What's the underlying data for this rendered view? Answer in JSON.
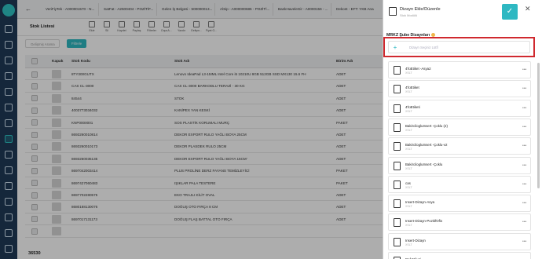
{
  "tabs": [
    {
      "label": "VeriFiyTek - A000001570 - N..."
    },
    {
      "label": "SatFat - A2500404 - POZİTİF..."
    },
    {
      "label": "Gelen İş Belgesi - 500000013..."
    },
    {
      "label": "AlSip - A000000685 - POZİTİ..."
    },
    {
      "label": "BankHaveleGir - A0000156 - ..."
    },
    {
      "label": "Dekont - EFT: YKB Ana"
    }
  ],
  "toolbar": {
    "title": "Stok Listesi",
    "buttons": [
      {
        "label": "Ekle",
        "icon": "plus-icon"
      },
      {
        "label": "Sil",
        "icon": "trash-icon"
      },
      {
        "label": "Kaydet",
        "icon": "save-icon"
      },
      {
        "label": "Paylaş",
        "icon": "share-icon"
      },
      {
        "label": "Filtreler",
        "icon": "filter-icon"
      },
      {
        "label": "Dışa A...",
        "icon": "export-icon"
      },
      {
        "label": "Yazdır",
        "icon": "print-icon"
      },
      {
        "label": "Gelişm...",
        "icon": "advanced-icon"
      },
      {
        "label": "Fiyat G...",
        "icon": "price-icon"
      }
    ]
  },
  "search": {
    "placeholder": "Gelişmiş Arama"
  },
  "filter_button": "Filtrele",
  "table": {
    "headers": {
      "image": "Kapak",
      "code": "Stok Kodu",
      "name": "Stok Adı",
      "unit": "Birim Adı"
    },
    "rows": [
      {
        "code": "8TY300GUTX",
        "name": "Lenovo IdeaPad L3-15IML Intel Core i5 10210U 8GB 512GB SSD MX130 15.6 FHD N...",
        "unit": "ADET"
      },
      {
        "code": "CAS CL-3000",
        "name": "CAS CL-3000 BARKODLU TERAZİ - 30 KG",
        "unit": "ADET"
      },
      {
        "code": "84544",
        "name": "STOK",
        "unit": "ADET"
      },
      {
        "code": "4003773034032",
        "name": "KANİPEX YAN KESKİ",
        "unit": "ADET"
      },
      {
        "code": "KNP0000001",
        "name": "SOS PLASTİK KORUMALI MURÇ",
        "unit": "PAKET"
      },
      {
        "code": "8693260010814",
        "name": "DEKOR EXPORT RULO YAĞLI BOYA 25CM",
        "unit": "ADET"
      },
      {
        "code": "8693260010173",
        "name": "DEKOR PLASDEK RULO 25CM",
        "unit": "ADET"
      },
      {
        "code": "8693260035135",
        "name": "DEKOR EXPORT RULO YAĞLI BOYA 15CM'",
        "unit": "ADET"
      },
      {
        "code": "8697042003414",
        "name": "PLUS PROLİNE DERZ FAYANS TEMİZLEYİCİ",
        "unit": "PAKET"
      },
      {
        "code": "8697427060483",
        "name": "IŞIKLAR PALA TESTERE",
        "unit": "PAKET"
      },
      {
        "code": "8697702280575",
        "name": "EKO TRAJLI KİLİT OVAL",
        "unit": "ADET"
      },
      {
        "code": "8680188130076",
        "name": "DOĞUŞ OTO FIRÇA 8 CM",
        "unit": "ADET"
      },
      {
        "code": "8697017131173",
        "name": "DOĞUŞ FLAŞ BATTAL OTO FIRÇA",
        "unit": "ADET"
      },
      {
        "code": "",
        "name": "",
        "unit": ""
      }
    ]
  },
  "footer": {
    "count": "36530"
  },
  "panel": {
    "title": "Dizayn Ekle/Düzenle",
    "subtitle": "Stok Modülü",
    "section_title": "MRKZ Şube Dizaynları",
    "add_placeholder": "Dizayn Seçiniz Lütfl",
    "items": [
      {
        "name": "4'lüEtiket -Asya2",
        "type": "XSLT"
      },
      {
        "name": "4'lüEtiket",
        "type": "XSLT"
      },
      {
        "name": "4'lüEtiketi",
        "type": "XSLT"
      },
      {
        "name": "BakircilogluInsert -Çoklu (2)",
        "type": "XSLT"
      },
      {
        "name": "BakircilogluInsert -Çoklu-v2",
        "type": "XSLT"
      },
      {
        "name": "BakircilogluInsert -Çoklu",
        "type": "XSLT"
      },
      {
        "name": "cas",
        "type": "XSLT"
      },
      {
        "name": "Insert-Dizayn-Asya",
        "type": "XSLT"
      },
      {
        "name": "Insert-Dizayn-PozitifOfis",
        "type": "XSLT"
      },
      {
        "name": "Insert-Dizayn",
        "type": "XSLT"
      },
      {
        "name": "Raf Etiketi-",
        "type": "XSLT"
      }
    ]
  },
  "colors": {
    "nav": "#1f3a58",
    "accent": "#2eb8c2",
    "highlight": "#d0292f"
  }
}
